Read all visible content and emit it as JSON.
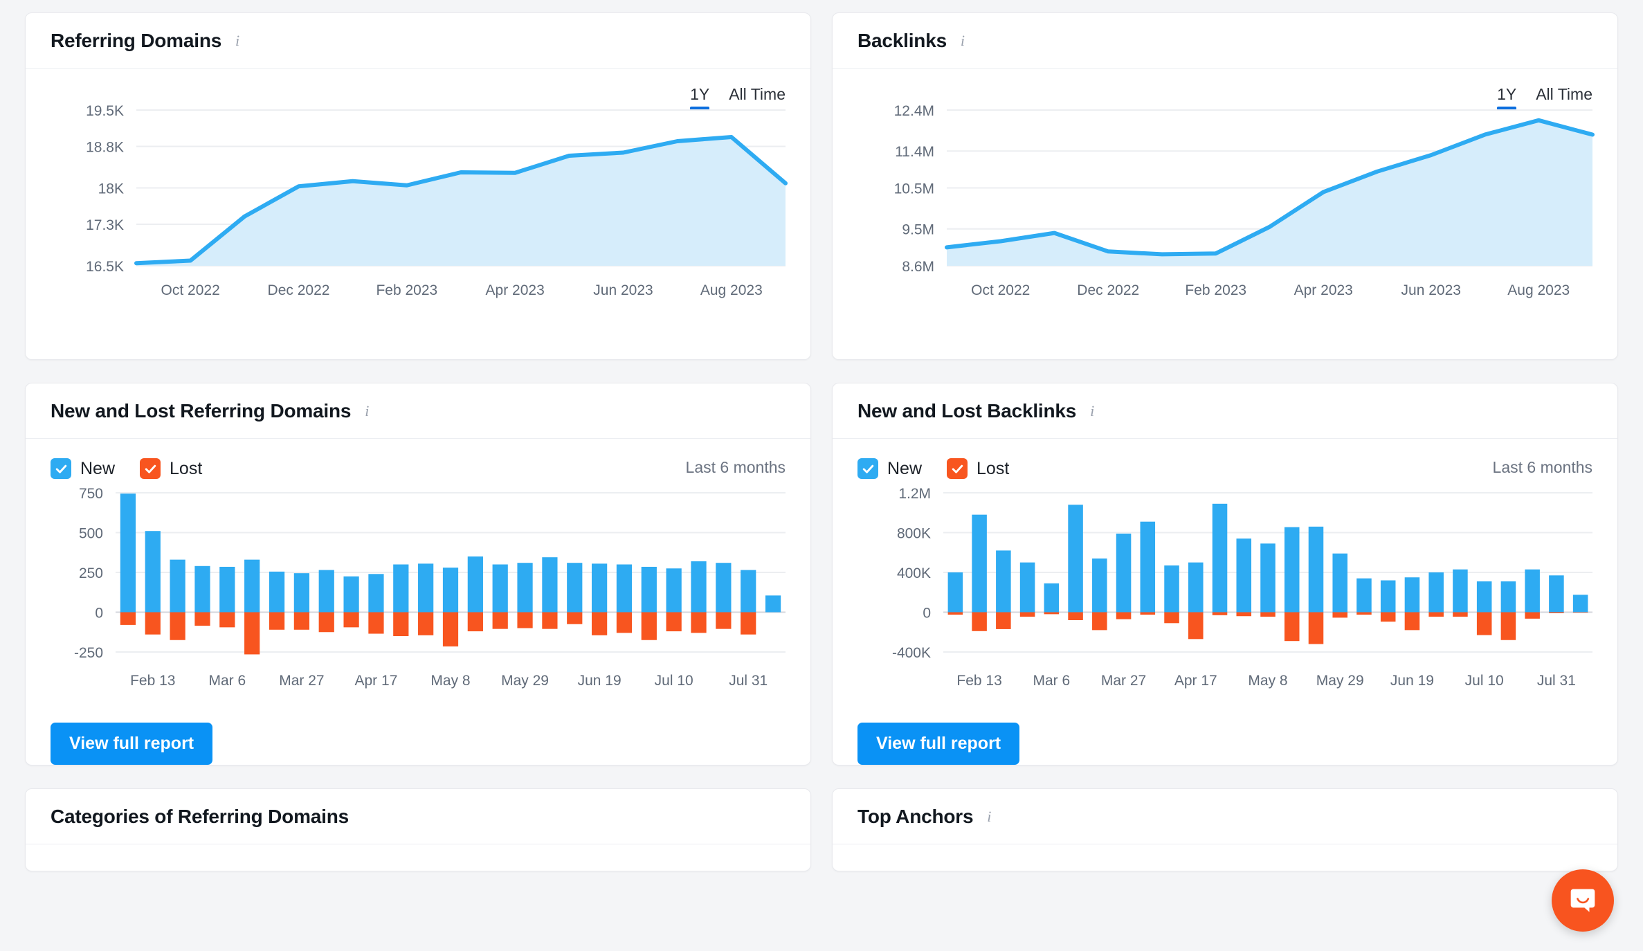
{
  "panels": {
    "referring_domains": {
      "title": "Referring Domains",
      "info_icon": "info-icon",
      "tabs": [
        {
          "label": "1Y",
          "active": true
        },
        {
          "label": "All Time",
          "active": false
        }
      ]
    },
    "backlinks": {
      "title": "Backlinks",
      "info_icon": "info-icon",
      "tabs": [
        {
          "label": "1Y",
          "active": true
        },
        {
          "label": "All Time",
          "active": false
        }
      ]
    },
    "new_lost_referring_domains": {
      "title": "New and Lost Referring Domains",
      "info_icon": "info-icon",
      "legend": [
        {
          "label": "New",
          "color": "#2eabf2",
          "checked": true
        },
        {
          "label": "Lost",
          "color": "#f8551f",
          "checked": true
        }
      ],
      "range_label": "Last 6 months",
      "button_label": "View full report"
    },
    "new_lost_backlinks": {
      "title": "New and Lost Backlinks",
      "info_icon": "info-icon",
      "legend": [
        {
          "label": "New",
          "color": "#2eabf2",
          "checked": true
        },
        {
          "label": "Lost",
          "color": "#f8551f",
          "checked": true
        }
      ],
      "range_label": "Last 6 months",
      "button_label": "View full report"
    },
    "categories_of_referring_domains": {
      "title": "Categories of Referring Domains"
    },
    "top_anchors": {
      "title": "Top Anchors",
      "info_icon": "info-icon"
    }
  },
  "chat_widget": {
    "icon": "chat-bubble-icon",
    "color": "#f8541f"
  },
  "chart_data": [
    {
      "id": "referring-domains-area",
      "type": "area",
      "title": "Referring Domains",
      "xlabel": "",
      "ylabel": "",
      "grid": true,
      "legend": "none",
      "line_color": "#2eabf2",
      "fill_color": "#d6edfb",
      "ytick_labels": [
        "19.5K",
        "18.8K",
        "18K",
        "17.3K",
        "16.5K"
      ],
      "ytick_values": [
        19500,
        18800,
        18000,
        17300,
        16500
      ],
      "ylim": [
        16500,
        19500
      ],
      "xtick_labels": [
        "Oct 2022",
        "Dec 2022",
        "Feb 2023",
        "Apr 2023",
        "Jun 2023",
        "Aug 2023"
      ],
      "x": [
        "Sep 2022",
        "Oct 2022",
        "Nov 2022",
        "Dec 2022",
        "Jan 2023",
        "Feb 2023",
        "Mar 2023",
        "Apr 2023",
        "May 2023",
        "Jun 2023",
        "Jul 2023",
        "Aug 2023",
        "Sep 2023"
      ],
      "values": [
        16550,
        16600,
        17450,
        18030,
        18130,
        18050,
        18300,
        18290,
        18620,
        18680,
        18900,
        18980,
        18090
      ]
    },
    {
      "id": "backlinks-area",
      "type": "area",
      "title": "Backlinks",
      "xlabel": "",
      "ylabel": "",
      "grid": true,
      "legend": "none",
      "line_color": "#2eabf2",
      "fill_color": "#d6edfb",
      "ytick_labels": [
        "12.4M",
        "11.4M",
        "10.5M",
        "9.5M",
        "8.6M"
      ],
      "ytick_values": [
        12400000,
        11400000,
        10500000,
        9500000,
        8600000
      ],
      "ylim": [
        8600000,
        12400000
      ],
      "xtick_labels": [
        "Oct 2022",
        "Dec 2022",
        "Feb 2023",
        "Apr 2023",
        "Jun 2023",
        "Aug 2023"
      ],
      "x": [
        "Sep 2022",
        "Oct 2022",
        "Nov 2022",
        "Dec 2022",
        "Jan 2023",
        "Feb 2023",
        "Mar 2023",
        "Apr 2023",
        "May 2023",
        "Jun 2023",
        "Jul 2023",
        "Aug 2023",
        "Sep 2023"
      ],
      "values": [
        9050000,
        9200000,
        9400000,
        8950000,
        8880000,
        8900000,
        9550000,
        10400000,
        10900000,
        11300000,
        11800000,
        12150000,
        11800000
      ]
    },
    {
      "id": "new-lost-referring-domains-bars",
      "type": "bar",
      "title": "New and Lost Referring Domains",
      "stacked": false,
      "grid": true,
      "legend": "top-left",
      "ytick_labels": [
        "750",
        "500",
        "250",
        "0",
        "-250"
      ],
      "ytick_values": [
        750,
        500,
        250,
        0,
        -250
      ],
      "ylim": [
        -250,
        750
      ],
      "xtick_labels": [
        "Feb 13",
        "Mar 6",
        "Mar 27",
        "Apr 17",
        "May 8",
        "May 29",
        "Jun 19",
        "Jul 10",
        "Jul 31"
      ],
      "series": [
        {
          "name": "New",
          "color": "#2eabf2",
          "values": [
            745,
            510,
            330,
            290,
            285,
            330,
            255,
            245,
            265,
            225,
            240,
            300,
            305,
            280,
            350,
            300,
            310,
            345,
            310,
            305,
            300,
            285,
            275,
            320,
            310,
            265,
            105
          ]
        },
        {
          "name": "Lost",
          "color": "#f8551f",
          "values": [
            -80,
            -140,
            -175,
            -85,
            -95,
            -265,
            -110,
            -110,
            -125,
            -95,
            -135,
            -150,
            -145,
            -215,
            -120,
            -105,
            -100,
            -105,
            -75,
            -145,
            -130,
            -175,
            -120,
            -130,
            -105,
            -140,
            0
          ]
        }
      ]
    },
    {
      "id": "new-lost-backlinks-bars",
      "type": "bar",
      "title": "New and Lost Backlinks",
      "stacked": false,
      "grid": true,
      "legend": "top-left",
      "ytick_labels": [
        "1.2M",
        "800K",
        "400K",
        "0",
        "-400K"
      ],
      "ytick_values": [
        1200000,
        800000,
        400000,
        0,
        -400000
      ],
      "ylim": [
        -400000,
        1200000
      ],
      "xtick_labels": [
        "Feb 13",
        "Mar 6",
        "Mar 27",
        "Apr 17",
        "May 8",
        "May 29",
        "Jun 19",
        "Jul 10",
        "Jul 31"
      ],
      "series": [
        {
          "name": "New",
          "color": "#2eabf2",
          "values": [
            400000,
            980000,
            620000,
            500000,
            290000,
            1080000,
            540000,
            790000,
            910000,
            470000,
            500000,
            1090000,
            740000,
            690000,
            855000,
            860000,
            590000,
            340000,
            320000,
            350000,
            400000,
            430000,
            310000,
            310000,
            430000,
            370000,
            175000
          ]
        },
        {
          "name": "Lost",
          "color": "#f8551f",
          "values": [
            -25000,
            -190000,
            -170000,
            -45000,
            -20000,
            -80000,
            -180000,
            -70000,
            -25000,
            -110000,
            -270000,
            -30000,
            -40000,
            -45000,
            -290000,
            -320000,
            -55000,
            -25000,
            -95000,
            -180000,
            -45000,
            -45000,
            -230000,
            -280000,
            -65000,
            -10000,
            -5000
          ]
        }
      ]
    }
  ]
}
